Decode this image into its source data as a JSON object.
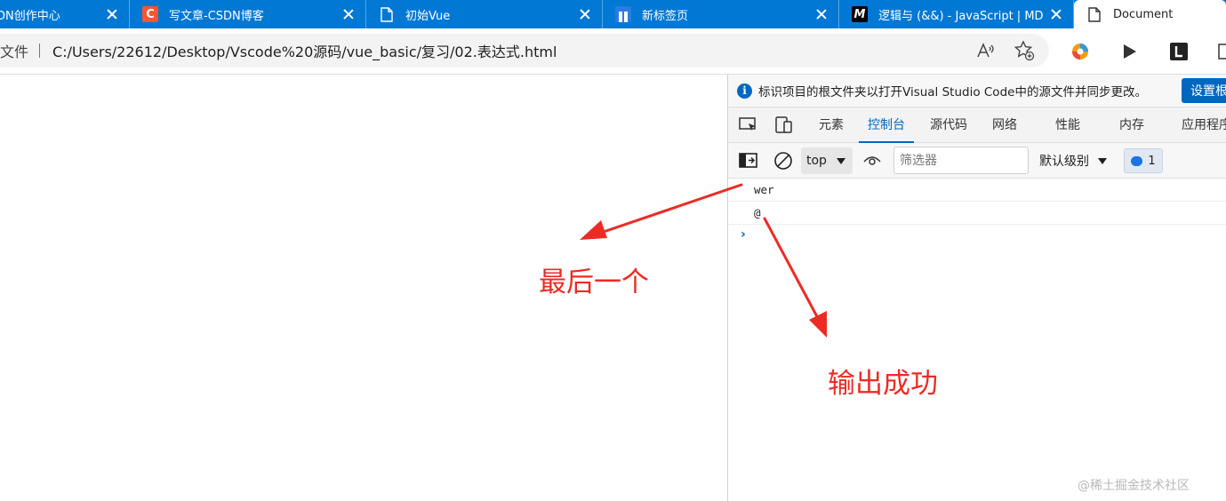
{
  "browser": {
    "tabs": [
      {
        "title": "DN创作中心",
        "favicon": "csdn-icon"
      },
      {
        "title": "写文章-CSDN博客",
        "favicon": "csdn-c-icon"
      },
      {
        "title": "初始Vue",
        "favicon": "document-icon"
      },
      {
        "title": "新标签页",
        "favicon": "new-tab-icon"
      },
      {
        "title": "逻辑与 (&&) - JavaScript | MDN",
        "favicon": "mdn-icon"
      },
      {
        "title": "Document",
        "favicon": "document-icon"
      }
    ],
    "address": {
      "scheme": "文件",
      "url": "C:/Users/22612/Desktop/Vscode%20源码/vue_basic/复习/02.表达式.html"
    }
  },
  "devtools": {
    "infobar": {
      "text": "标识项目的根文件夹以打开Visual Studio Code中的源文件并同步更改。",
      "button": "设置根"
    },
    "tabs": [
      "元素",
      "控制台",
      "源代码",
      "网络",
      "性能",
      "内存",
      "应用程序"
    ],
    "active_tab": "控制台",
    "console_toolbar": {
      "context": "top",
      "filter_placeholder": "筛选器",
      "levels": "默认级别",
      "message_count": "1"
    },
    "console_lines": [
      "wer",
      "@"
    ],
    "prompt": "›"
  },
  "annotations": {
    "left_label": "最后一个",
    "right_label": "输出成功",
    "color": "#ec2b24"
  },
  "watermark": "@稀土掘金技术社区"
}
